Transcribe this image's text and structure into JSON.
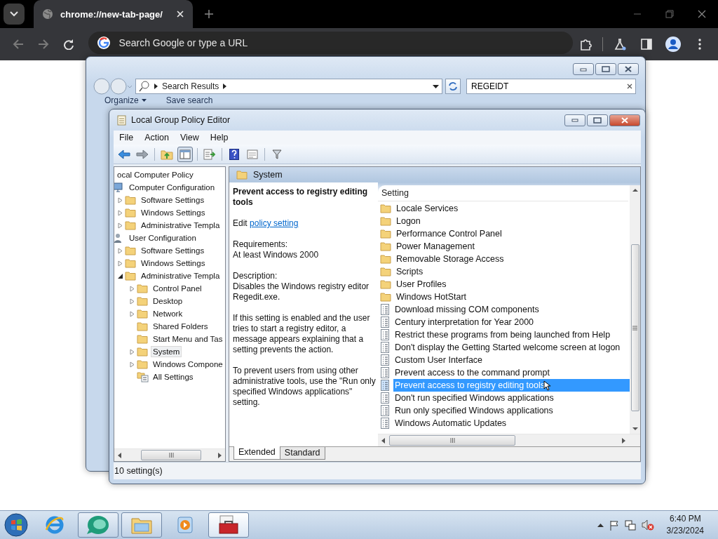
{
  "browser": {
    "tab_title": "chrome://new-tab-page/",
    "omnibox_placeholder": "Search Google or type a URL"
  },
  "explorer": {
    "address": "Search Results",
    "search_value": "REGEIDT",
    "toolbar": [
      {
        "label": "Organize",
        "kind": "menu"
      },
      {
        "label": "Save search",
        "kind": "plain"
      }
    ]
  },
  "gpe": {
    "title": "Local Group Policy Editor",
    "menu": [
      "File",
      "Action",
      "View",
      "Help"
    ],
    "tree": [
      {
        "label": "ocal Computer Policy",
        "selected": false,
        "children": [
          {
            "label": "Computer Configuration",
            "kind": "computer",
            "selected": false,
            "children": [
              {
                "label": "Software Settings",
                "kind": "folder",
                "expandable": true,
                "expanded": false,
                "selected": false
              },
              {
                "label": "Windows Settings",
                "kind": "folder",
                "expandable": true,
                "expanded": false,
                "selected": false
              },
              {
                "label": "Administrative Templa",
                "kind": "folder",
                "expandable": true,
                "expanded": false,
                "selected": false
              }
            ]
          },
          {
            "label": "User Configuration",
            "kind": "user",
            "selected": false,
            "children": [
              {
                "label": "Software Settings",
                "kind": "folder",
                "expandable": true,
                "expanded": false,
                "selected": false
              },
              {
                "label": "Windows Settings",
                "kind": "folder",
                "expandable": true,
                "expanded": false,
                "selected": false
              },
              {
                "label": "Administrative Templa",
                "kind": "folder",
                "expandable": true,
                "expanded": true,
                "selected": false,
                "children": [
                  {
                    "label": "Control Panel",
                    "kind": "folder",
                    "expandable": true,
                    "expanded": false,
                    "selected": false
                  },
                  {
                    "label": "Desktop",
                    "kind": "folder",
                    "expandable": true,
                    "expanded": false,
                    "selected": false
                  },
                  {
                    "label": "Network",
                    "kind": "folder",
                    "expandable": true,
                    "expanded": false,
                    "selected": false
                  },
                  {
                    "label": "Shared Folders",
                    "kind": "folder",
                    "expandable": false,
                    "selected": false
                  },
                  {
                    "label": "Start Menu and Tas",
                    "kind": "folder",
                    "expandable": false,
                    "selected": false
                  },
                  {
                    "label": "System",
                    "kind": "folder",
                    "expandable": true,
                    "expanded": false,
                    "selected": true
                  },
                  {
                    "label": "Windows Compone",
                    "kind": "folder",
                    "expandable": true,
                    "expanded": false,
                    "selected": false
                  },
                  {
                    "label": "All Settings",
                    "kind": "all-settings",
                    "expandable": false,
                    "selected": false
                  }
                ]
              }
            ]
          }
        ]
      }
    ],
    "header": "System",
    "details": {
      "title": "Prevent access to registry editing tools",
      "edit_label": "Edit",
      "edit_link": "policy setting",
      "paragraphs": [
        "Requirements:\nAt least Windows 2000",
        "Description:\nDisables the Windows registry editor Regedit.exe.",
        "If this setting is enabled and the user tries to start a registry editor, a message appears explaining that a setting prevents the action.",
        "To prevent users from using other administrative tools, use the \"Run only specified Windows applications\" setting."
      ]
    },
    "column": "Setting",
    "settings": [
      {
        "label": "Locale Services",
        "kind": "folder",
        "selected": false
      },
      {
        "label": "Logon",
        "kind": "folder",
        "selected": false
      },
      {
        "label": "Performance Control Panel",
        "kind": "folder",
        "selected": false
      },
      {
        "label": "Power Management",
        "kind": "folder",
        "selected": false
      },
      {
        "label": "Removable Storage Access",
        "kind": "folder",
        "selected": false
      },
      {
        "label": "Scripts",
        "kind": "folder",
        "selected": false
      },
      {
        "label": "User Profiles",
        "kind": "folder",
        "selected": false
      },
      {
        "label": "Windows HotStart",
        "kind": "folder",
        "selected": false
      },
      {
        "label": "Download missing COM components",
        "kind": "policy",
        "selected": false
      },
      {
        "label": "Century interpretation for Year 2000",
        "kind": "policy",
        "selected": false
      },
      {
        "label": "Restrict these programs from being launched from Help",
        "kind": "policy",
        "selected": false
      },
      {
        "label": "Don't display the Getting Started welcome screen at logon",
        "kind": "policy",
        "selected": false
      },
      {
        "label": "Custom User Interface",
        "kind": "policy",
        "selected": false
      },
      {
        "label": "Prevent access to the command prompt",
        "kind": "policy",
        "selected": false
      },
      {
        "label": "Prevent access to registry editing tools",
        "kind": "policy",
        "selected": true
      },
      {
        "label": "Don't run specified Windows applications",
        "kind": "policy",
        "selected": false
      },
      {
        "label": "Run only specified Windows applications",
        "kind": "policy",
        "selected": false
      },
      {
        "label": "Windows Automatic Updates",
        "kind": "policy",
        "selected": false
      }
    ],
    "tabs": [
      {
        "label": "Extended",
        "selected": true
      },
      {
        "label": "Standard",
        "selected": false
      }
    ],
    "status": "10 setting(s)"
  },
  "taskbar": {
    "apps": [
      {
        "kind": "ie",
        "open": false,
        "active": false
      },
      {
        "kind": "orb",
        "open": true,
        "active": false
      },
      {
        "kind": "folder",
        "open": true,
        "active": false
      },
      {
        "kind": "media",
        "open": false,
        "active": false
      },
      {
        "kind": "toolbox",
        "open": true,
        "active": true
      }
    ],
    "time": "6:40 PM",
    "date": "3/23/2024"
  }
}
